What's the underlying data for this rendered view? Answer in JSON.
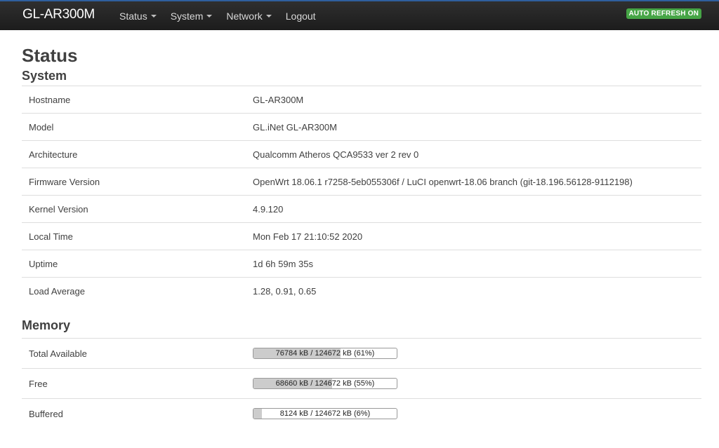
{
  "navbar": {
    "brand": "GL-AR300M",
    "menu": [
      {
        "label": "Status",
        "dropdown": true
      },
      {
        "label": "System",
        "dropdown": true
      },
      {
        "label": "Network",
        "dropdown": true
      },
      {
        "label": "Logout",
        "dropdown": false
      }
    ],
    "auto_refresh": "AUTO REFRESH ON"
  },
  "page_title": "Status",
  "system": {
    "title": "System",
    "rows": [
      {
        "label": "Hostname",
        "value": "GL-AR300M"
      },
      {
        "label": "Model",
        "value": "GL.iNet GL-AR300M"
      },
      {
        "label": "Architecture",
        "value": "Qualcomm Atheros QCA9533 ver 2 rev 0"
      },
      {
        "label": "Firmware Version",
        "value": "OpenWrt 18.06.1 r7258-5eb055306f / LuCI openwrt-18.06 branch (git-18.196.56128-9112198)"
      },
      {
        "label": "Kernel Version",
        "value": "4.9.120"
      },
      {
        "label": "Local Time",
        "value": "Mon Feb 17 21:10:52 2020"
      },
      {
        "label": "Uptime",
        "value": "1d 6h 59m 35s"
      },
      {
        "label": "Load Average",
        "value": "1.28, 0.91, 0.65"
      }
    ]
  },
  "memory": {
    "title": "Memory",
    "rows": [
      {
        "label": "Total Available",
        "bar_text": "76784 kB / 124672 kB (61%)",
        "percent": 61
      },
      {
        "label": "Free",
        "bar_text": "68660 kB / 124672 kB (55%)",
        "percent": 55
      },
      {
        "label": "Buffered",
        "bar_text": "8124 kB / 124672 kB (6%)",
        "percent": 6
      }
    ]
  },
  "colors": {
    "navbar_bg": "#1c1c1c",
    "auto_refresh_bg": "#46a546",
    "bar_fill": "#cccccc"
  }
}
